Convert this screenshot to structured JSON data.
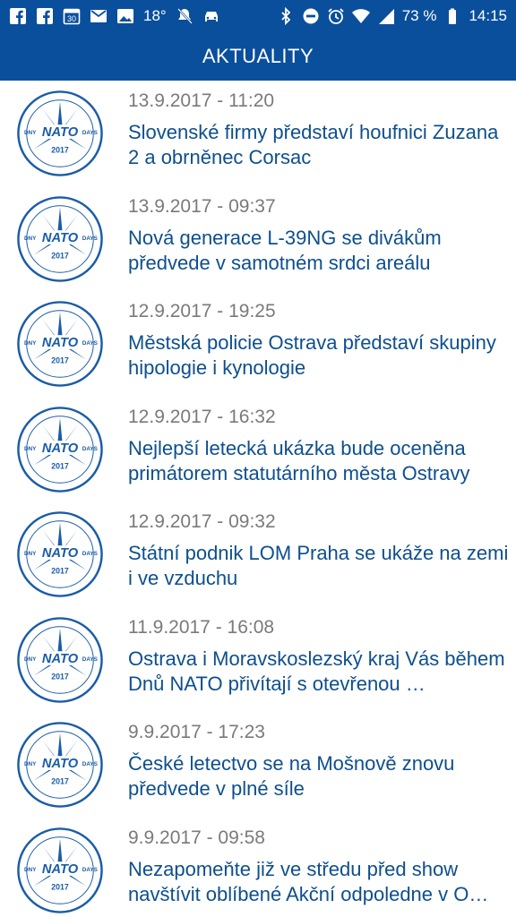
{
  "status_bar": {
    "temperature": "18°",
    "battery": "73 %",
    "time": "14:15",
    "left_icons": [
      "facebook-icon",
      "facebook-icon",
      "calendar-icon",
      "mail-icon",
      "image-icon"
    ],
    "right_icons": [
      "bluetooth-icon",
      "do-not-disturb-icon",
      "alarm-icon",
      "wifi-icon",
      "signal-icon",
      "battery-icon"
    ],
    "calendar_day": "30"
  },
  "header": {
    "title": "AKTUALITY"
  },
  "logo": {
    "top_left": "DNY",
    "center": "NATO",
    "top_right": "DAYS",
    "year": "2017"
  },
  "colors": {
    "brand": "#0a4f9c",
    "title": "#0d4f8e",
    "date": "#7a7a7a"
  },
  "news": [
    {
      "date": "13.9.2017 - 11:20",
      "title": "Slovenské firmy představí houfnici Zuzana 2 a obrněnec Corsac"
    },
    {
      "date": "13.9.2017 - 09:37",
      "title": "Nová generace L-39NG se divákům předvede v samotném srdci areálu"
    },
    {
      "date": "12.9.2017 - 19:25",
      "title": "Městská policie Ostrava představí skupiny hipologie i kynologie"
    },
    {
      "date": "12.9.2017 - 16:32",
      "title": "Nejlepší letecká ukázka bude oceněna primátorem statutárního města Ostravy"
    },
    {
      "date": "12.9.2017 - 09:32",
      "title": "Státní podnik LOM Praha se ukáže na zemi i ve vzduchu"
    },
    {
      "date": "11.9.2017 - 16:08",
      "title": "Ostrava i Moravskoslezský kraj Vás během Dnů NATO přivítají s otevřenou …"
    },
    {
      "date": "9.9.2017 - 17:23",
      "title": "České letectvo se na Mošnově znovu předvede v plné síle"
    },
    {
      "date": "9.9.2017 - 09:58",
      "title": "Nezapomeňte již ve středu před show navštívit oblíbené Akční odpoledne v O…"
    }
  ]
}
